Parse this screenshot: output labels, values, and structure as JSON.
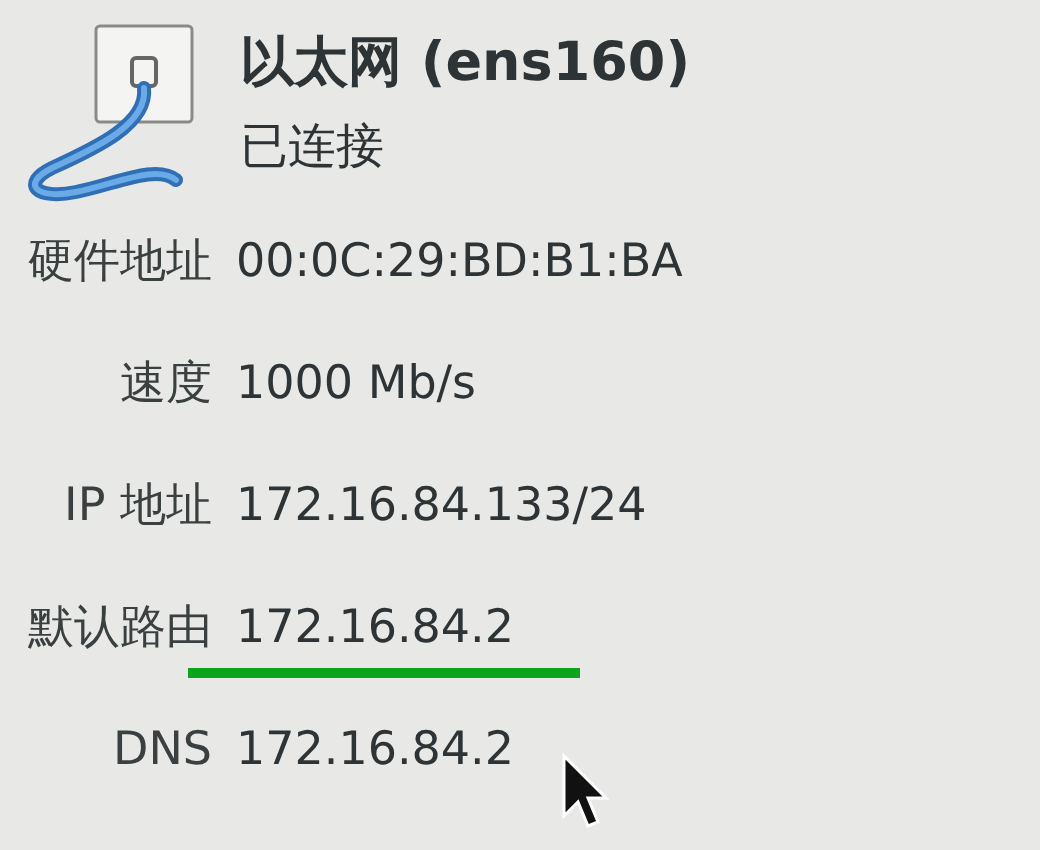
{
  "header": {
    "title": "以太网 (ens160)",
    "status": "已连接"
  },
  "details": [
    {
      "label": "硬件地址",
      "value": "00:0C:29:BD:B1:BA",
      "underlined": false
    },
    {
      "label": "速度",
      "value": "1000 Mb/s",
      "underlined": false
    },
    {
      "label": "IP 地址",
      "value": "172.16.84.133/24",
      "underlined": false
    },
    {
      "label": "默认路由",
      "value": "172.16.84.2",
      "underlined": true
    },
    {
      "label": "DNS",
      "value": "172.16.84.2",
      "underlined": false
    }
  ]
}
